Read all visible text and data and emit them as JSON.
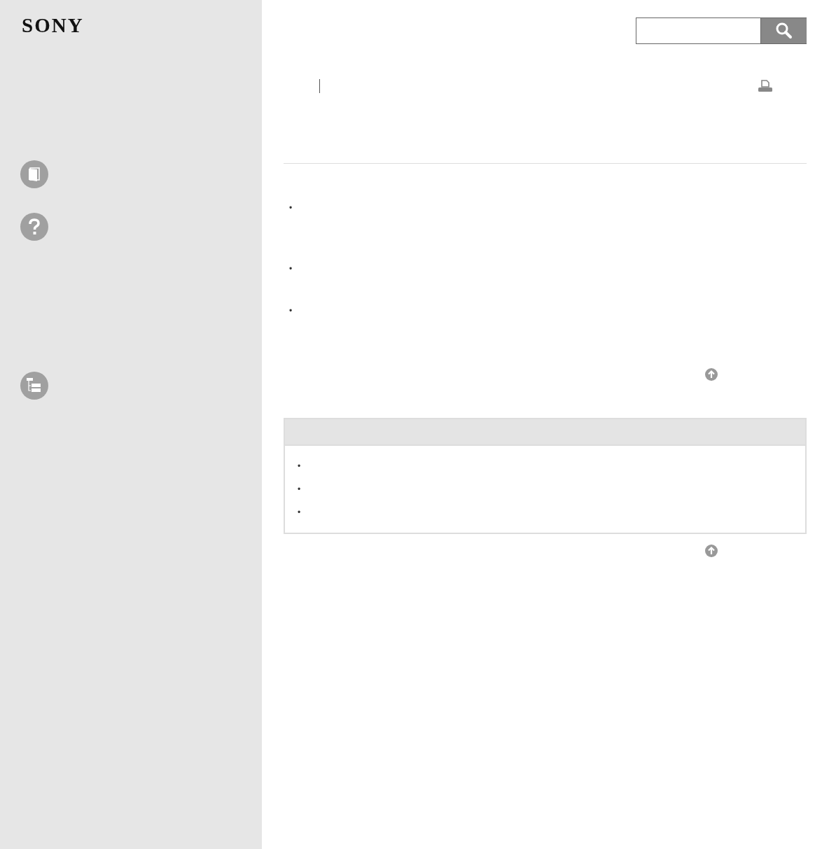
{
  "logo": "SONY",
  "content": {
    "bullets": [
      "•",
      "•",
      "•"
    ]
  },
  "related": {
    "bullets": [
      "•",
      "•",
      "•"
    ]
  }
}
